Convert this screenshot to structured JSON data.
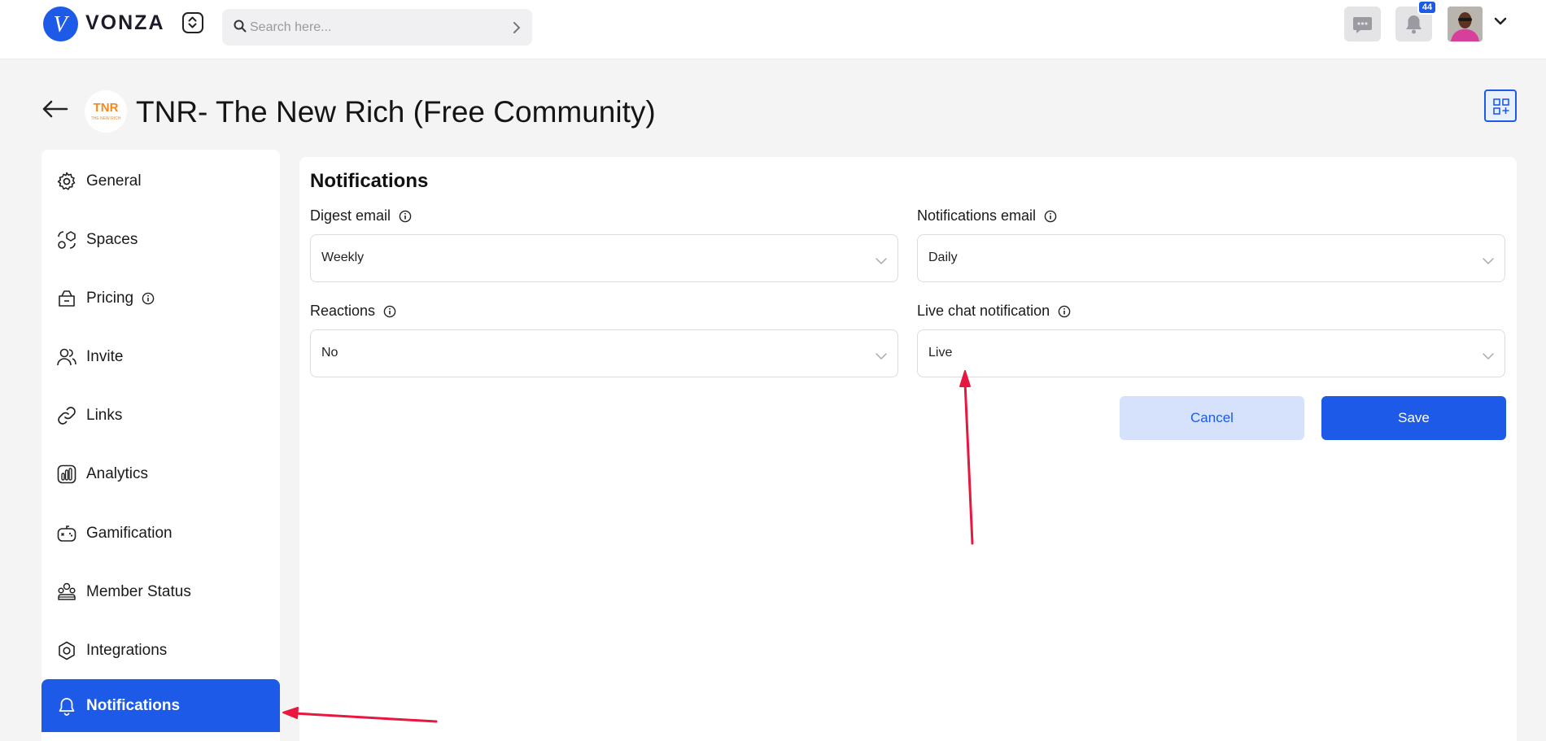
{
  "app": {
    "logo_letter": "V",
    "name": "VONZA"
  },
  "search": {
    "placeholder": "Search here..."
  },
  "topbar": {
    "notification_count": "44",
    "icons": [
      "chat-icon",
      "bell-icon",
      "chevron-down-icon"
    ]
  },
  "header": {
    "logo_text": "TNR",
    "logo_subtext": "THE NEW RICH",
    "title": "TNR- The New Rich (Free Community)"
  },
  "sidebar": {
    "items": [
      {
        "label": "General",
        "icon": "gear-icon"
      },
      {
        "label": "Spaces",
        "icon": "spaces-icon"
      },
      {
        "label": "Pricing",
        "icon": "pricing-icon"
      },
      {
        "label": "Invite",
        "icon": "users-icon"
      },
      {
        "label": "Links",
        "icon": "link-icon"
      },
      {
        "label": "Analytics",
        "icon": "analytics-icon"
      },
      {
        "label": "Gamification",
        "icon": "gamepad-icon"
      },
      {
        "label": "Member Status",
        "icon": "member-status-icon"
      },
      {
        "label": "Integrations",
        "icon": "integrations-icon"
      },
      {
        "label": "Notifications",
        "icon": "bell-icon",
        "active": true
      }
    ]
  },
  "panel": {
    "title": "Notifications",
    "fields": {
      "digest_email": {
        "label": "Digest email",
        "value": "Weekly"
      },
      "notifications_email": {
        "label": "Notifications email",
        "value": "Daily"
      },
      "reactions": {
        "label": "Reactions",
        "value": "No"
      },
      "live_chat": {
        "label": "Live chat notification",
        "value": "Live"
      }
    },
    "cancel_label": "Cancel",
    "save_label": "Save"
  },
  "colors": {
    "accent": "#1e5ae8",
    "cancel_bg": "#d6e2fb",
    "page_bg": "#f4f4f5",
    "annotation": "#e8173f"
  }
}
